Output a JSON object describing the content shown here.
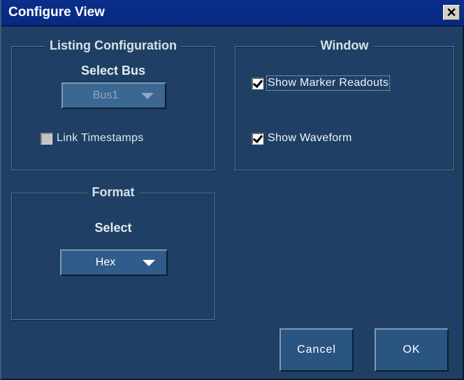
{
  "window": {
    "title": "Configure View",
    "close_glyph": "✕"
  },
  "listing_configuration": {
    "legend": "Listing Configuration",
    "select_bus_label": "Select Bus",
    "bus_dropdown": {
      "value": "Bus1",
      "enabled": false
    },
    "link_timestamps": {
      "label": "Link Timestamps",
      "checked": false,
      "enabled": false
    }
  },
  "window_group": {
    "legend": "Window",
    "show_marker_readouts": {
      "label": "Show Marker Readouts",
      "checked": true
    },
    "show_waveform": {
      "label": "Show Waveform",
      "checked": true
    }
  },
  "format": {
    "legend": "Format",
    "select_label": "Select",
    "format_dropdown": {
      "value": "Hex",
      "enabled": true
    }
  },
  "buttons": {
    "cancel": "Cancel",
    "ok": "OK"
  },
  "colors": {
    "dialog_bg": "#1f4064",
    "titlebar": "#0a2f8a",
    "button_bg": "#2a5580"
  }
}
